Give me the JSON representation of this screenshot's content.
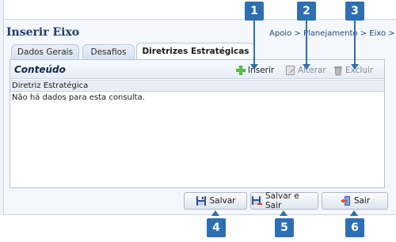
{
  "header": {
    "title": "Inserir Eixo",
    "breadcrumb": "Apoio > Planejamento > Eixo >"
  },
  "tabs": [
    {
      "label": "Dados Gerais",
      "active": false
    },
    {
      "label": "Desafios",
      "active": false
    },
    {
      "label": "Diretrizes Estratégicas",
      "active": true
    }
  ],
  "content": {
    "title": "Conteúdo",
    "toolbar": {
      "insert_label": "Inserir",
      "edit_label": "Alterar",
      "delete_label": "Excluir"
    },
    "grid": {
      "column_header": "Diretriz Estratégica",
      "empty_message": "Não há dados para esta consulta."
    }
  },
  "footer": {
    "save_label": "Salvar",
    "save_exit_label": "Salvar e Sair",
    "exit_label": "Sair"
  },
  "callouts": [
    "1",
    "2",
    "3",
    "4",
    "5",
    "6"
  ],
  "icons": {
    "insert": "plus-icon",
    "edit": "edit-icon",
    "delete": "trash-icon",
    "save": "floppy-disk-icon",
    "save_exit": "floppy-disk-exit-icon",
    "exit": "exit-door-icon"
  },
  "colors": {
    "accent": "#2e6fb3",
    "title": "#1f3d6e",
    "insert_icon": "#3ea034"
  }
}
